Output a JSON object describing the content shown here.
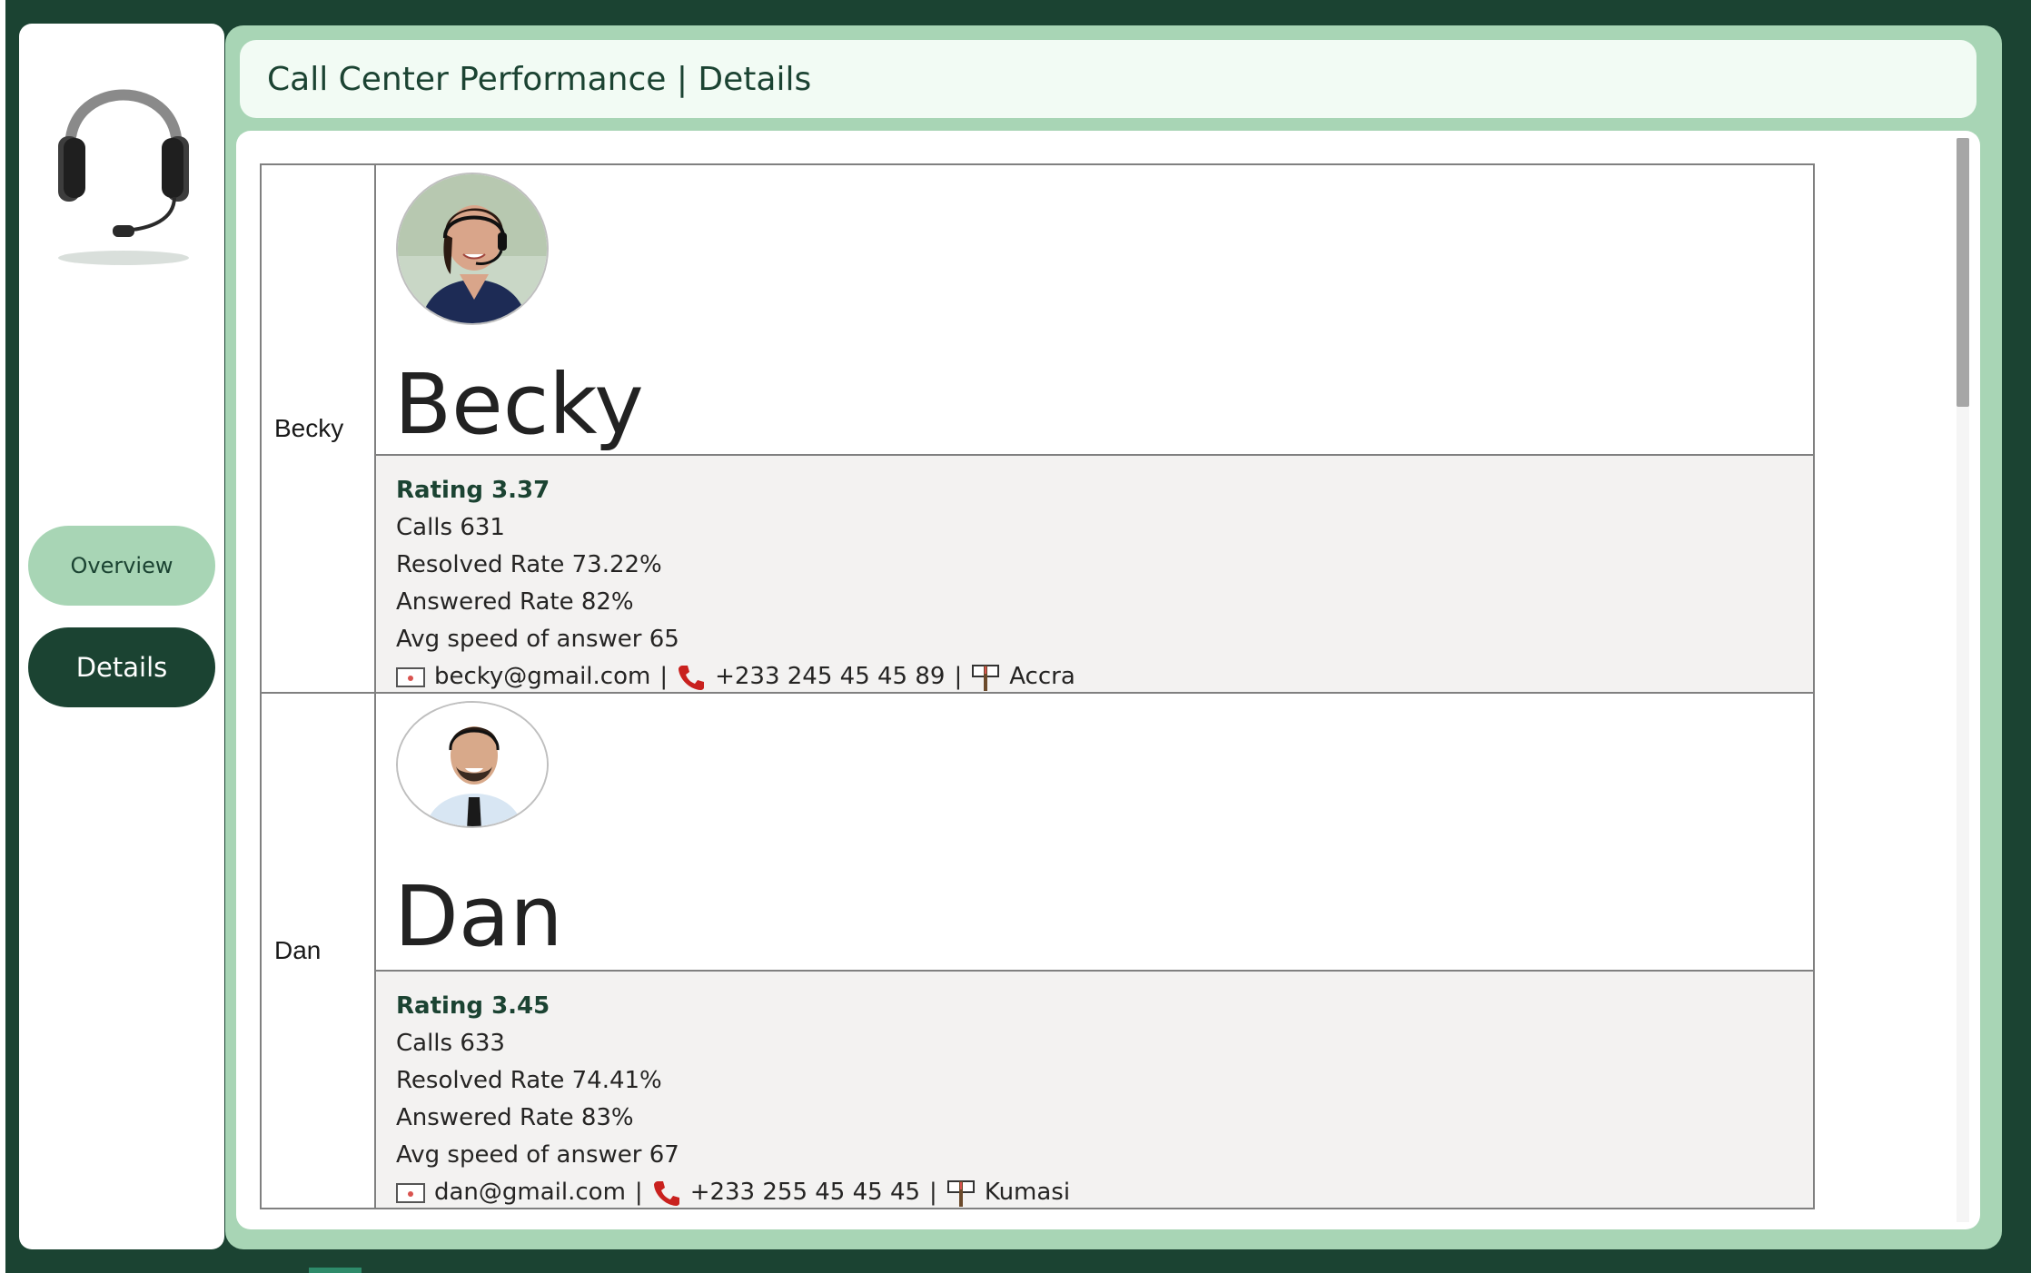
{
  "app": {
    "title": "Call Center Performance | Details"
  },
  "nav": {
    "overview_label": "Overview",
    "details_label": "Details",
    "active": "Details"
  },
  "agents": [
    {
      "row_label": "Becky",
      "name": "Becky",
      "rating": "Rating 3.37",
      "calls": "Calls 631",
      "resolved_rate": "Resolved Rate 73.22%",
      "answered_rate": "Answered Rate 82%",
      "avg_speed": "Avg speed of answer 65",
      "email": "becky@gmail.com",
      "phone": "+233 245 45 45 89",
      "city": "Accra"
    },
    {
      "row_label": "Dan",
      "name": "Dan",
      "rating": "Rating 3.45",
      "calls": "Calls 633",
      "resolved_rate": "Resolved Rate 74.41%",
      "answered_rate": "Answered Rate 83%",
      "avg_speed": "Avg speed of answer 67",
      "email": "dan@gmail.com",
      "phone": "+233 255 45 45 45",
      "city": "Kumasi"
    }
  ],
  "separator": "|",
  "icons": {
    "logo": "headset-icon",
    "email": "envelope-icon",
    "phone": "phone-icon",
    "location": "signpost-icon"
  },
  "colors": {
    "background": "#1b4332",
    "accent_light": "#a8d5b5",
    "accent_dark": "#1b4332",
    "title_bg": "#f2fbf4",
    "rating_text": "#1b4332"
  }
}
